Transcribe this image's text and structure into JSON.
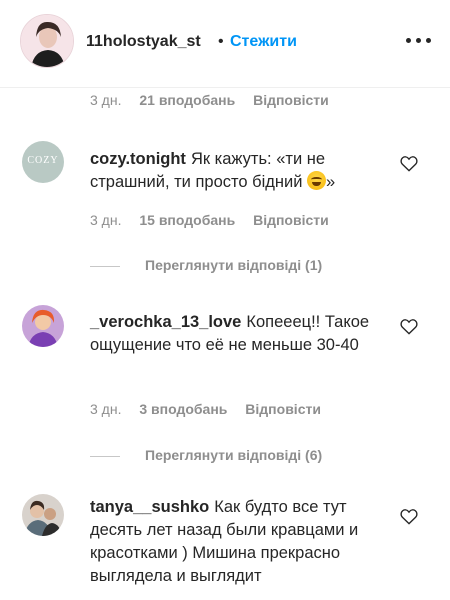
{
  "header": {
    "username": "11holostyak_st",
    "separator": "•",
    "follow_label": "Стежити"
  },
  "top_meta": {
    "age": "3 дн.",
    "likes": "21 вподобань",
    "reply": "Відповісти"
  },
  "comments": [
    {
      "username": "cozy.tonight",
      "avatar_text": "COZY",
      "text": "Як кажуть: «ти не страшний, ти просто бідний",
      "text_end": "»",
      "emoji": "laughing-emoji",
      "age": "3 дн.",
      "likes": "15 вподобань",
      "reply": "Відповісти",
      "view_replies": "Переглянути відповіді (1)"
    },
    {
      "username": "_verochka_13_love",
      "text": "Копееец!! Такое ощущение что её не меньше 30-40",
      "age": "3 дн.",
      "likes": "3 вподобань",
      "reply": "Відповісти",
      "view_replies": "Переглянути відповіді (6)"
    },
    {
      "username": "tanya__sushko",
      "text": "Как будто все тут десять лет назад были кравцами и красотками ) Мишина прекрасно выглядела и выглядит"
    }
  ],
  "colors": {
    "accent": "#0095f6",
    "text": "#262626",
    "muted": "#8e8e8e"
  },
  "icons": [
    "more-options-icon",
    "heart-icon"
  ]
}
